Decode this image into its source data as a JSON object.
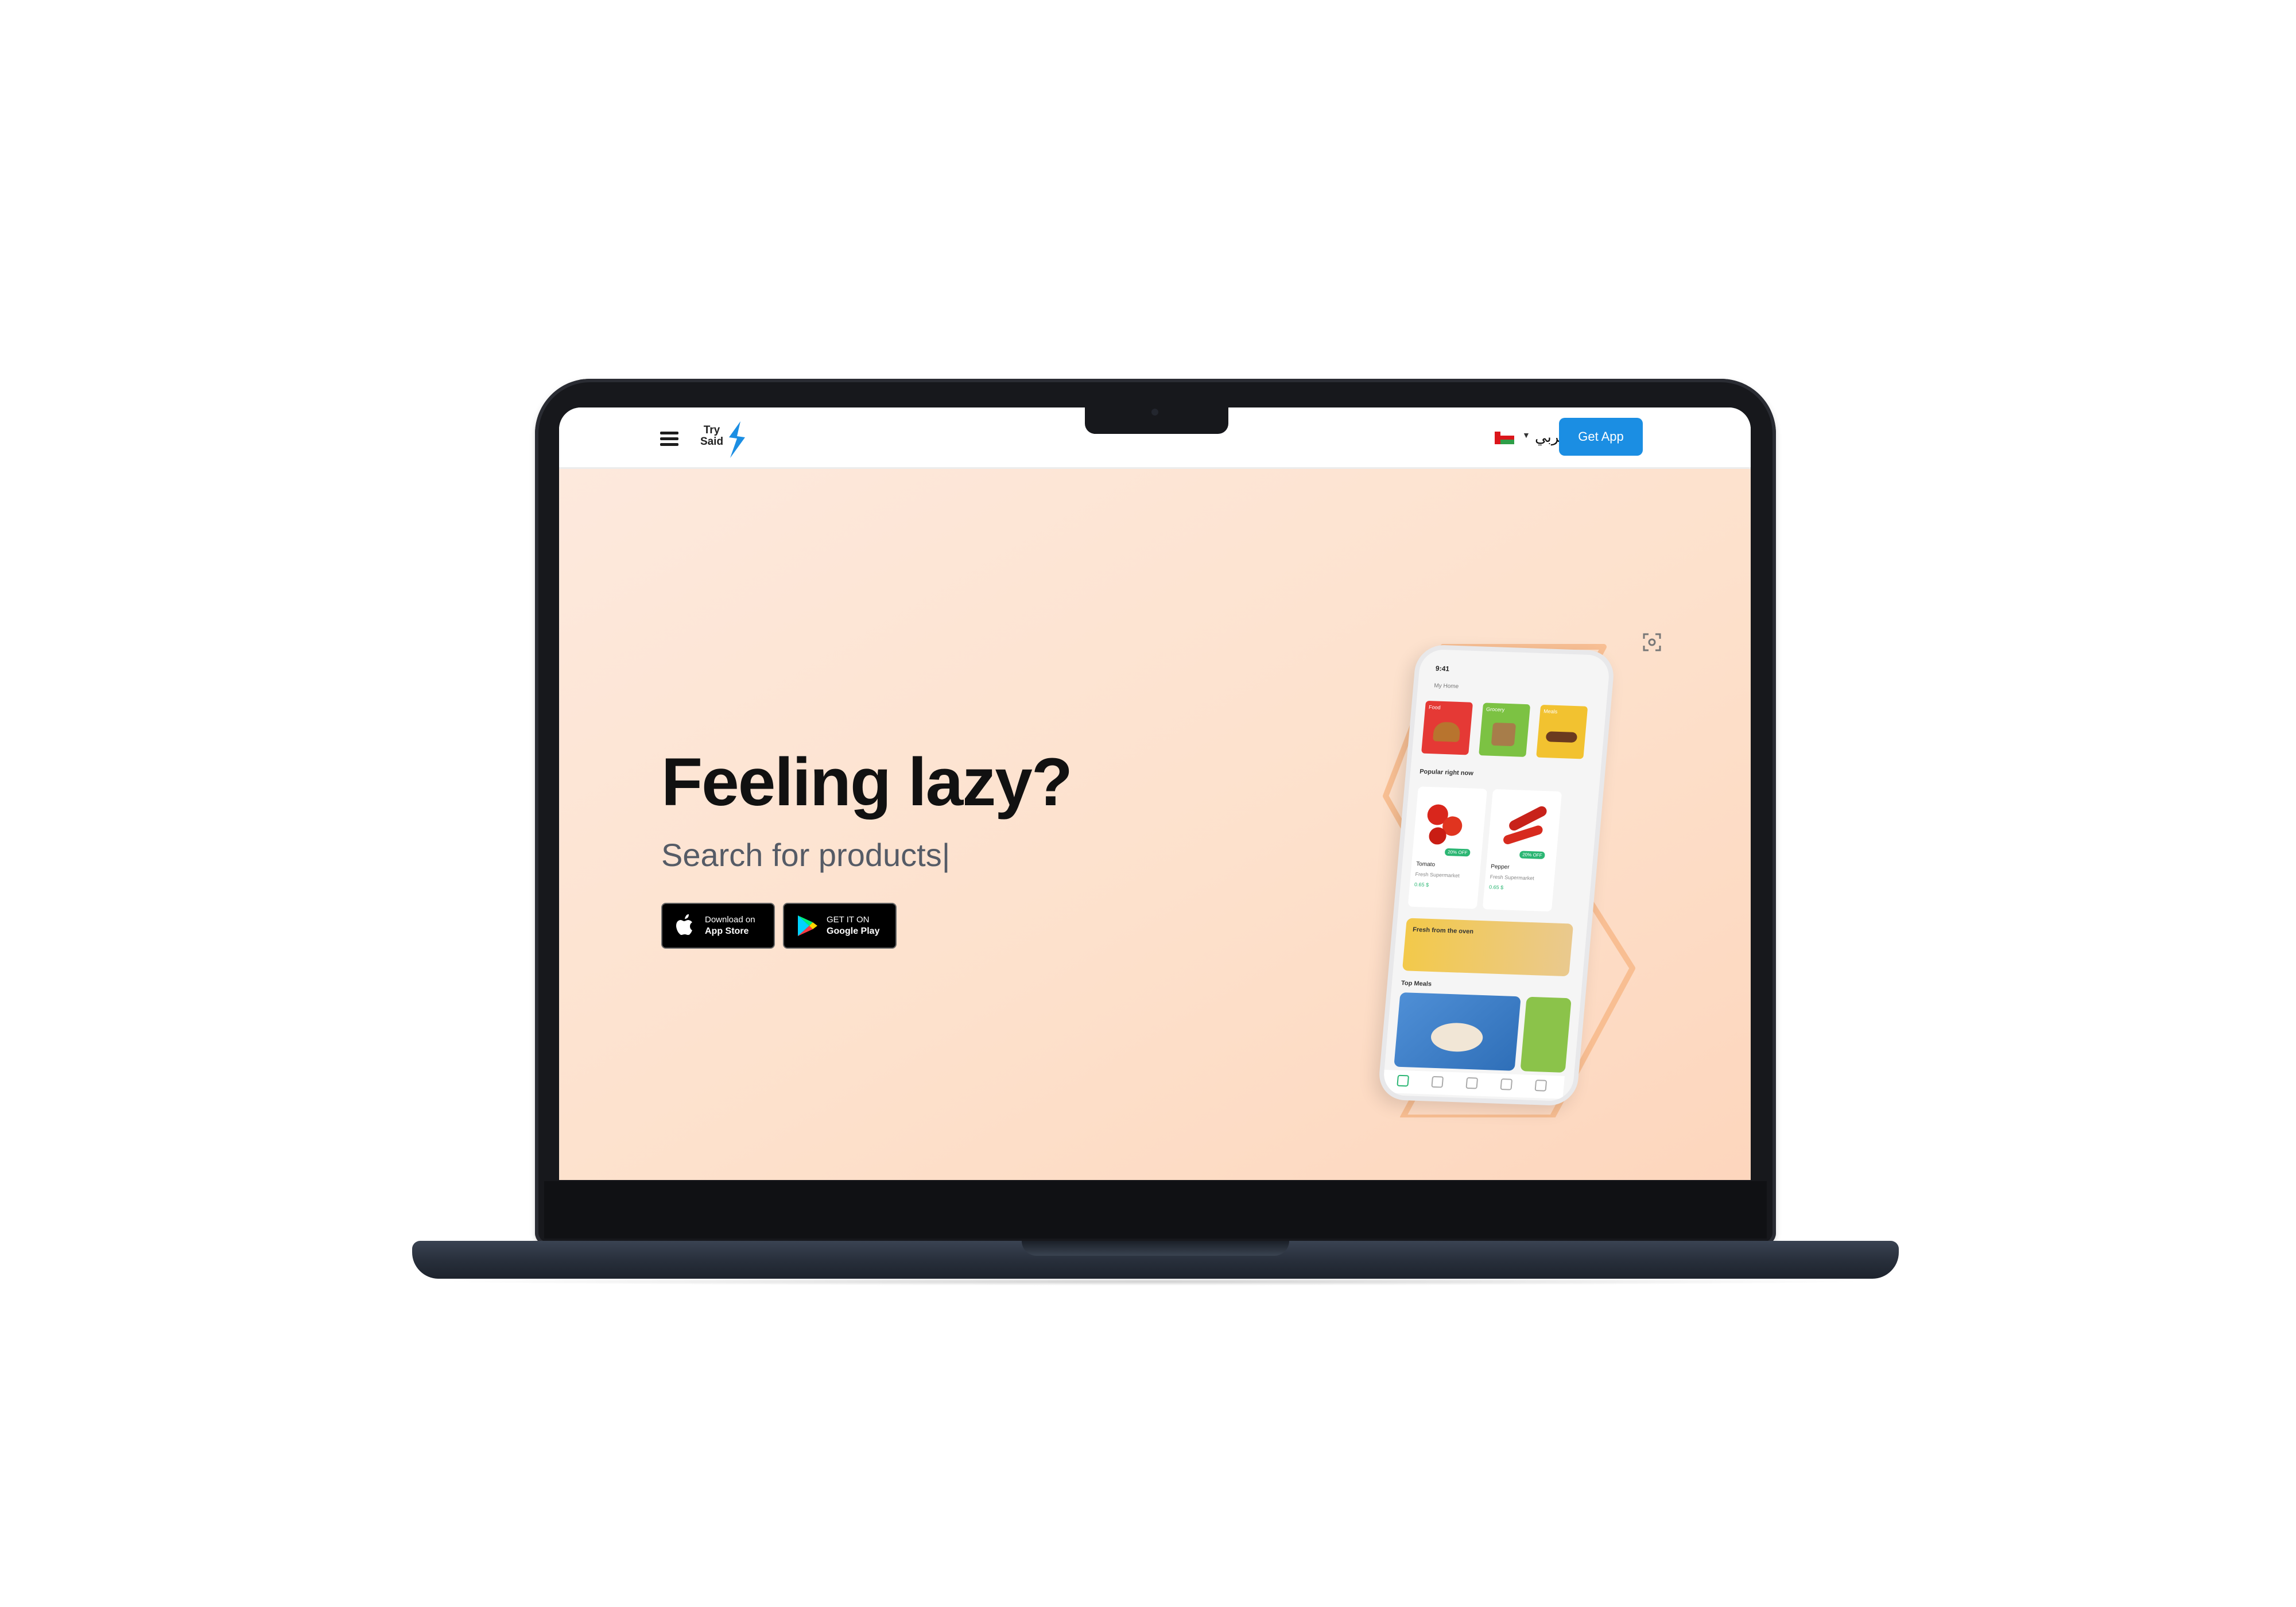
{
  "header": {
    "logo": {
      "line1": "Try",
      "line2": "Said"
    },
    "language_label": "عربي",
    "get_app_label": "Get App"
  },
  "hero": {
    "headline": "Feeling lazy?",
    "subline": "Search for products|"
  },
  "store_buttons": {
    "apple": {
      "line1": "Download on",
      "line2": "App Store"
    },
    "google": {
      "line1": "GET IT ON",
      "line2": "Google Play"
    }
  },
  "phone": {
    "time": "9:41",
    "location": "My Home",
    "categories": [
      "Food",
      "Grocery",
      "Meals"
    ],
    "popular_heading": "Popular right now",
    "products": [
      {
        "name": "Tomato",
        "shop": "Fresh Supermarket",
        "price": "0.65 $",
        "badge": "20% OFF"
      },
      {
        "name": "Pepper",
        "shop": "Fresh Supermarket",
        "price": "0.65 $",
        "badge": "20% OFF"
      }
    ],
    "banner": "Fresh from the oven",
    "top_meals_heading": "Top Meals"
  },
  "colors": {
    "accent": "#1b8ee3",
    "hero_bg": "#fde1cc",
    "laptop": "#17181c"
  }
}
